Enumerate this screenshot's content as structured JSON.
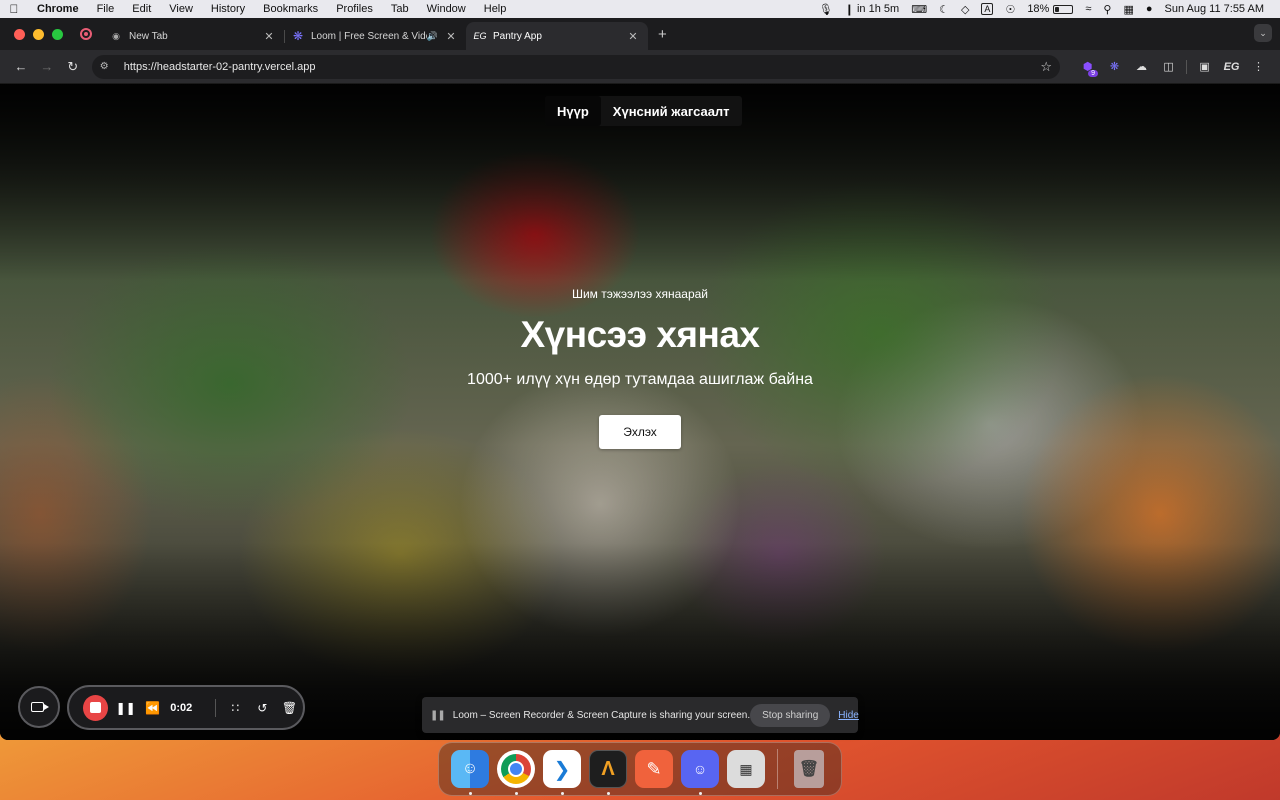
{
  "menubar": {
    "apple": "",
    "app_name": "Chrome",
    "items": [
      "File",
      "Edit",
      "View",
      "History",
      "Bookmarks",
      "Profiles",
      "Tab",
      "Window",
      "Help"
    ],
    "status": {
      "timer": "in 1h 5m",
      "input_source": "A",
      "battery": "18%",
      "battery_level": 0.18,
      "datetime": "Sun Aug 11  7:55 AM"
    }
  },
  "browser": {
    "tabs": [
      {
        "title": "New Tab",
        "favicon": "chrome-icon",
        "active": false
      },
      {
        "title": "Loom | Free Screen & Video Recording",
        "favicon": "loom-icon",
        "active": false,
        "audio": true
      },
      {
        "title": "Pantry App",
        "favicon_text": "EG",
        "active": true
      }
    ],
    "new_tab": "+",
    "url": "https://headstarter-02-pantry.vercel.app",
    "extensions": {
      "badge_count": "9",
      "profile": "EG"
    }
  },
  "page": {
    "nav": {
      "home": "Нүүр",
      "inventory": "Хүнсний жагсаалт"
    },
    "hero": {
      "eyebrow": "Шим тэжээлээ хянаарай",
      "headline": "Хүнсээ хянах",
      "subtitle": "1000+ илүү хүн өдөр тутамдаа ашиглаж байна",
      "cta": "Эхлэх"
    }
  },
  "loom": {
    "timer": "0:02",
    "share_banner": {
      "message": "Loom – Screen Recorder & Screen Capture is sharing your screen.",
      "stop": "Stop sharing",
      "hide": "Hide"
    }
  },
  "dock": {
    "apps": [
      "finder-icon",
      "chrome-icon",
      "vscode-icon",
      "arc-icon",
      "pencil-icon",
      "discord-icon",
      "calculator-icon",
      "trash-icon"
    ]
  }
}
